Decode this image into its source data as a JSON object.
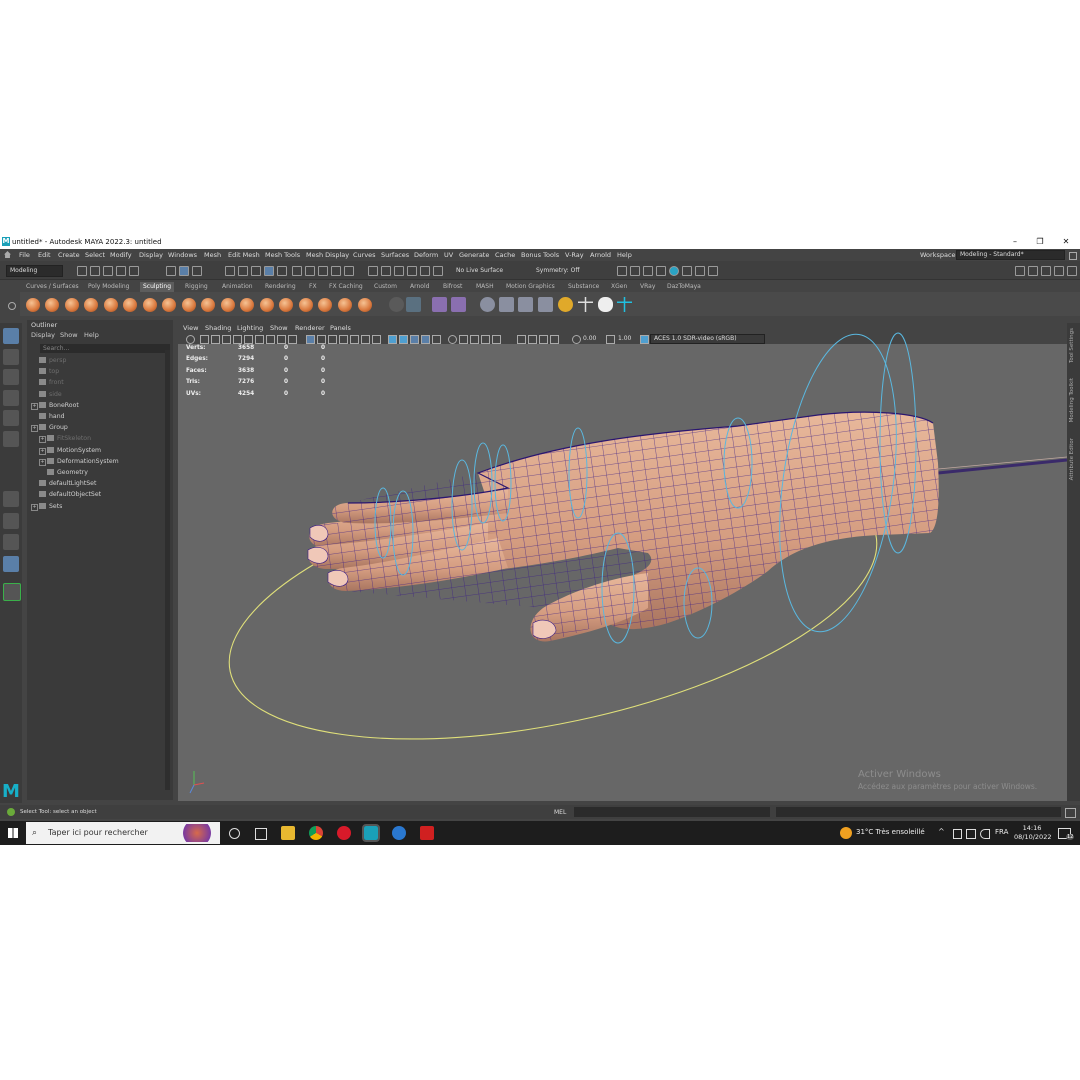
{
  "window": {
    "title": "untitled* - Autodesk MAYA 2022.3: untitled",
    "logo": "M",
    "min": "–",
    "max": "❐",
    "close": "✕"
  },
  "menubar": {
    "items": [
      "File",
      "Edit",
      "Create",
      "Select",
      "Modify",
      "Display",
      "Windows",
      "Mesh",
      "Edit Mesh",
      "Mesh Tools",
      "Mesh Display",
      "Curves",
      "Surfaces",
      "Deform",
      "UV",
      "Generate",
      "Cache",
      "Bonus Tools",
      "V-Ray",
      "Arnold",
      "Help"
    ],
    "workspace_label": "Workspace:",
    "workspace_value": "Modeling - Standard*"
  },
  "statusline": {
    "mode": "Modeling",
    "live_surface": "No Live Surface",
    "symmetry": "Symmetry: Off"
  },
  "shelf": {
    "tabs": [
      "Curves / Surfaces",
      "Poly Modeling",
      "Sculpting",
      "Rigging",
      "Animation",
      "Rendering",
      "FX",
      "FX Caching",
      "Custom",
      "Arnold",
      "Bifrost",
      "MASH",
      "Motion Graphics",
      "Substance",
      "XGen",
      "VRay",
      "DazToMaya"
    ],
    "active_tab": "Sculpting"
  },
  "outliner": {
    "title": "Outliner",
    "menu": [
      "Display",
      "Show",
      "Help"
    ],
    "search_placeholder": "Search...",
    "items": [
      {
        "label": "persp",
        "dim": true,
        "indent": 1,
        "expand": false
      },
      {
        "label": "top",
        "dim": true,
        "indent": 1,
        "expand": false
      },
      {
        "label": "front",
        "dim": true,
        "indent": 1,
        "expand": false
      },
      {
        "label": "side",
        "dim": true,
        "indent": 1,
        "expand": false
      },
      {
        "label": "BoneRoot",
        "dim": false,
        "indent": 1,
        "expand": true
      },
      {
        "label": "hand",
        "dim": false,
        "indent": 1,
        "expand": false
      },
      {
        "label": "Group",
        "dim": false,
        "indent": 1,
        "expand": true
      },
      {
        "label": "FitSkeleton",
        "dim": true,
        "indent": 2,
        "expand": true
      },
      {
        "label": "MotionSystem",
        "dim": false,
        "indent": 2,
        "expand": true
      },
      {
        "label": "DeformationSystem",
        "dim": false,
        "indent": 2,
        "expand": true
      },
      {
        "label": "Geometry",
        "dim": false,
        "indent": 2,
        "expand": false
      },
      {
        "label": "defaultLightSet",
        "dim": false,
        "indent": 1,
        "expand": false
      },
      {
        "label": "defaultObjectSet",
        "dim": false,
        "indent": 1,
        "expand": false
      },
      {
        "label": "Sets",
        "dim": false,
        "indent": 1,
        "expand": true
      }
    ]
  },
  "viewport": {
    "menu": [
      "View",
      "Shading",
      "Lighting",
      "Show",
      "Renderer",
      "Panels"
    ],
    "exposure": "0.00",
    "gamma": "1.00",
    "color_space": "ACES 1.0 SDR-video (sRGB)",
    "hud": [
      {
        "label": "Verts:",
        "v1": "3658",
        "v2": "0",
        "v3": "0"
      },
      {
        "label": "Edges:",
        "v1": "7294",
        "v2": "0",
        "v3": "0"
      },
      {
        "label": "Faces:",
        "v1": "3638",
        "v2": "0",
        "v3": "0"
      },
      {
        "label": "Tris:",
        "v1": "7276",
        "v2": "0",
        "v3": "0"
      },
      {
        "label": "UVs:",
        "v1": "4254",
        "v2": "0",
        "v3": "0"
      }
    ],
    "watermark_title": "Activer Windows",
    "watermark_sub": "Accédez aux paramètres pour activer Windows."
  },
  "right_tabs": [
    "Tool Settings",
    "Modeling Toolkit",
    "Attribute Editor"
  ],
  "helpline": {
    "text": "Select Tool: select an object",
    "mel": "MEL"
  },
  "taskbar": {
    "search": "Taper ici pour rechercher",
    "weather": "31°C  Très ensoleillé",
    "lang": "FRA",
    "time": "14:16",
    "date": "08/10/2022",
    "notif": "12"
  }
}
